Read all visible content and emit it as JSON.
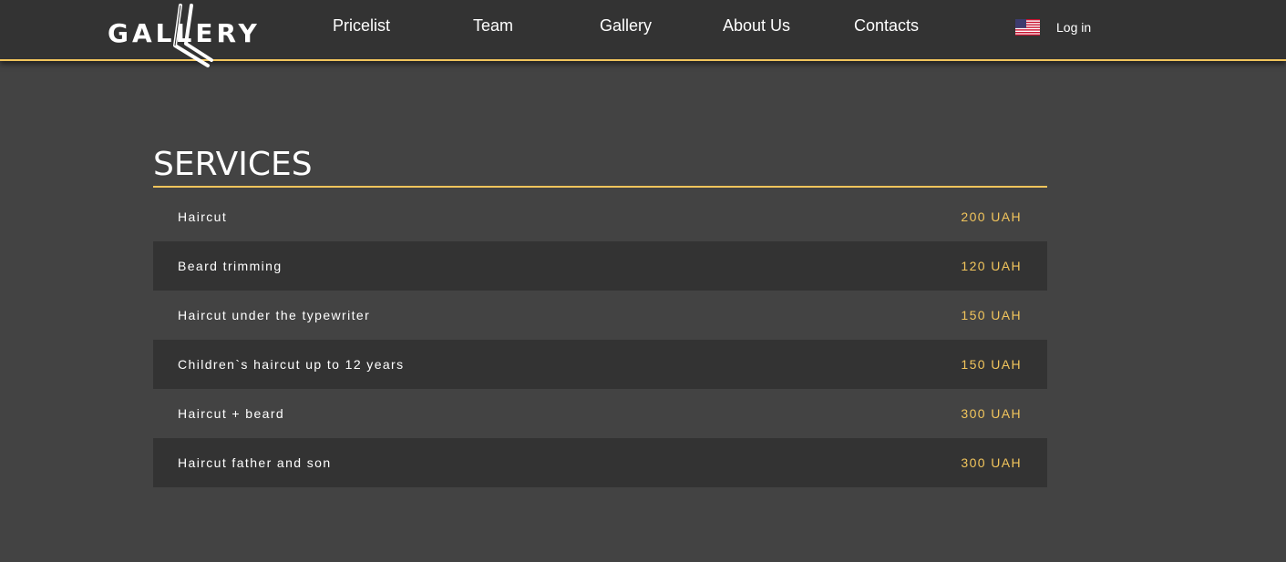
{
  "header": {
    "logo_text": "GALLERY",
    "nav": [
      {
        "label": "Pricelist"
      },
      {
        "label": "Team"
      },
      {
        "label": "Gallery"
      },
      {
        "label": "About Us"
      },
      {
        "label": "Contacts"
      }
    ],
    "language_icon": "us-flag-icon",
    "login_label": "Log in"
  },
  "main": {
    "title": "SERVICES",
    "services": [
      {
        "name": "Haircut",
        "price": "200 UAH"
      },
      {
        "name": "Beard trimming",
        "price": "120 UAH"
      },
      {
        "name": "Haircut under the typewriter",
        "price": "150 UAH"
      },
      {
        "name": "Children`s haircut up to 12 years",
        "price": "150 UAH"
      },
      {
        "name": "Haircut + beard",
        "price": "300 UAH"
      },
      {
        "name": "Haircut father and son",
        "price": "300 UAH"
      }
    ]
  },
  "colors": {
    "accent": "#f2c55c",
    "header_bg": "#333333",
    "page_bg": "#434343",
    "row_dark": "#333333"
  }
}
